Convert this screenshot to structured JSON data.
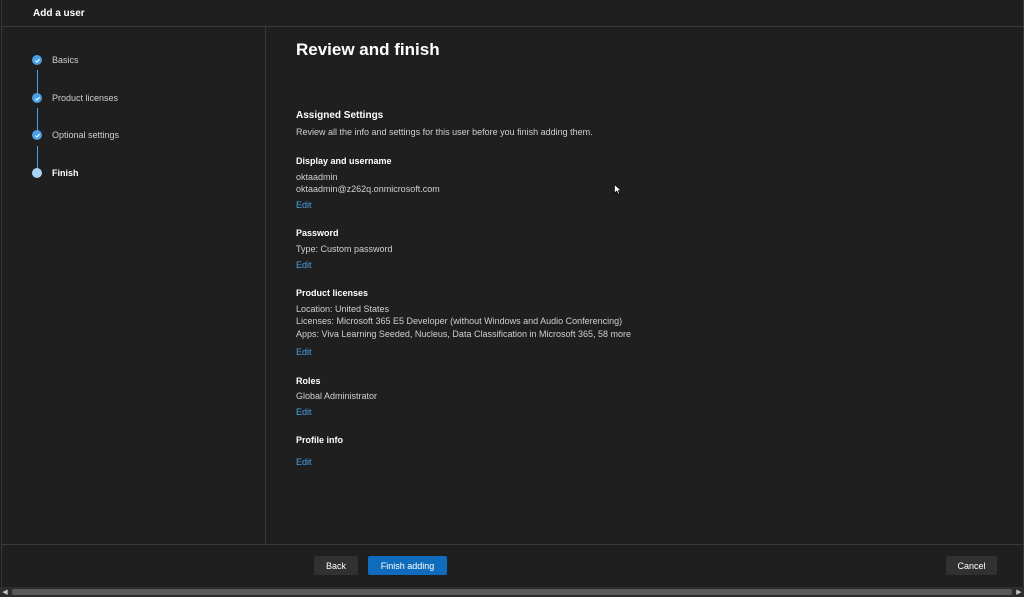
{
  "window": {
    "title": "Add a user"
  },
  "stepper": {
    "steps": [
      {
        "label": "Basics",
        "state": "complete"
      },
      {
        "label": "Product licenses",
        "state": "complete"
      },
      {
        "label": "Optional settings",
        "state": "complete"
      },
      {
        "label": "Finish",
        "state": "current"
      }
    ]
  },
  "main": {
    "page_title": "Review and finish",
    "assigned_heading": "Assigned Settings",
    "assigned_subtext": "Review all the info and settings for this user before you finish adding them.",
    "display": {
      "title": "Display and username",
      "name": "oktaadmin",
      "email": "oktaadmin@z262q.onmicrosoft.com",
      "edit": "Edit"
    },
    "password": {
      "title": "Password",
      "type": "Type: Custom password",
      "edit": "Edit"
    },
    "licenses": {
      "title": "Product licenses",
      "location": "Location: United States",
      "licenses": "Licenses: Microsoft 365 E5 Developer (without Windows and Audio Conferencing)",
      "apps": "Apps: Viva Learning Seeded, Nucleus, Data Classification in Microsoft 365, 58 more",
      "edit": "Edit"
    },
    "roles": {
      "title": "Roles",
      "value": "Global Administrator",
      "edit": "Edit"
    },
    "profile": {
      "title": "Profile info",
      "edit": "Edit"
    }
  },
  "footer": {
    "back": "Back",
    "finish": "Finish adding",
    "cancel": "Cancel"
  },
  "colors": {
    "accent": "#4aa0e6",
    "primary_button": "#0f6cbd",
    "background": "#1f1f1f"
  },
  "icons": {
    "step_complete": "checkmark-icon",
    "cursor": "mouse-pointer-icon"
  }
}
